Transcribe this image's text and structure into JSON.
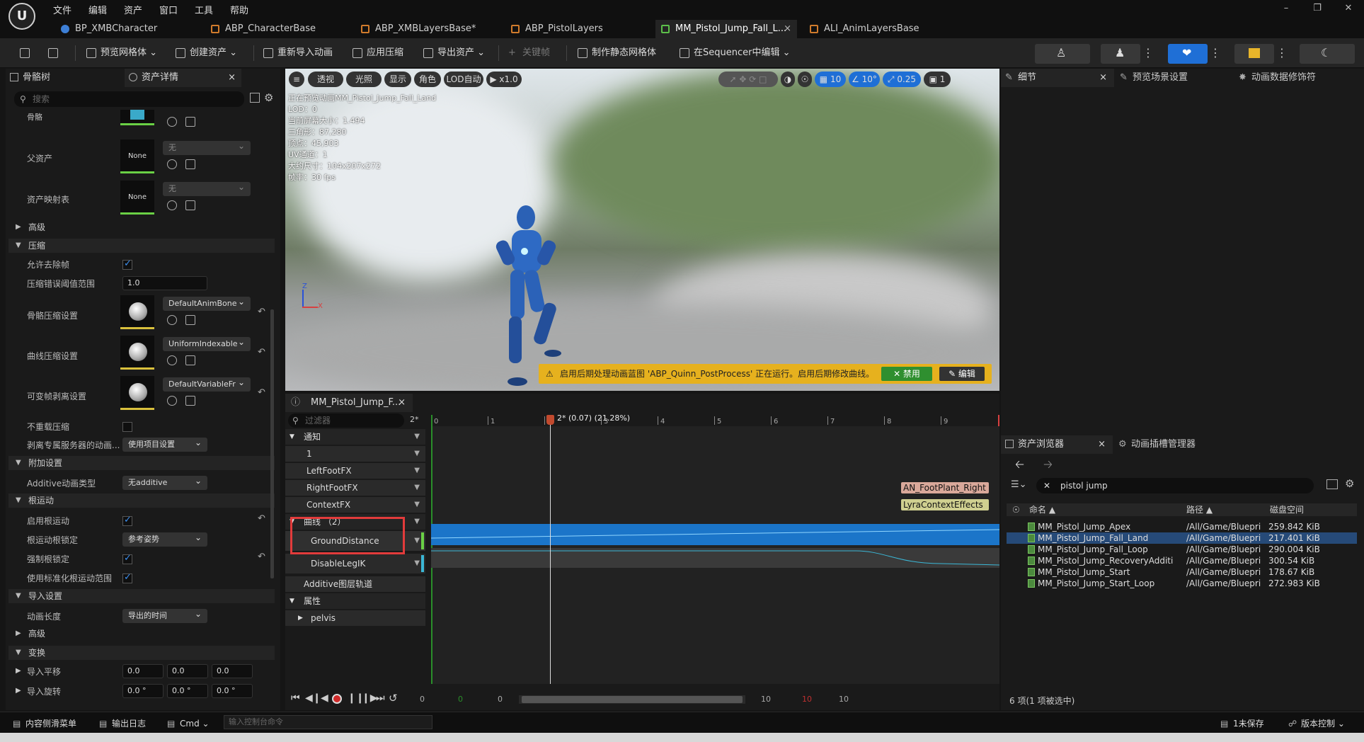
{
  "menu": {
    "items": [
      "文件",
      "编辑",
      "资产",
      "窗口",
      "工具",
      "帮助"
    ]
  },
  "tabs": [
    {
      "label": "BP_XMBCharacter"
    },
    {
      "label": "ABP_CharacterBase"
    },
    {
      "label": "ABP_XMBLayersBase*"
    },
    {
      "label": "ABP_PistolLayers"
    },
    {
      "label": "MM_Pistol_Jump_Fall_L...",
      "close": "×"
    },
    {
      "label": "ALI_AnimLayersBase"
    }
  ],
  "toolbar": {
    "preview_mesh": "预览网格体",
    "create_asset": "创建资产",
    "reimport": "重新导入动画",
    "apply_compression": "应用压缩",
    "export_asset": "导出资产",
    "keyframe": "关键帧",
    "make_static_mesh": "制作静态网格体",
    "edit_in_sequencer": "在Sequencer中编辑"
  },
  "left": {
    "tab_skeleton": "骨骼树",
    "tab_details": "资产详情",
    "tab_close": "×",
    "search_placeholder": "搜索",
    "label_skeleton": "骨骼",
    "label_parent": "父资产",
    "parent_value": "None",
    "parent_dd": "无",
    "label_mapping": "资产映射表",
    "mapping_value": "None",
    "mapping_dd": "无",
    "sec_advanced1": "高级",
    "sec_compression": "压缩",
    "allow_strip": "允许去除帧",
    "compress_err_label": "压缩错误阈值范围",
    "compress_err_value": "1.0",
    "bone_comp_label": "骨骼压缩设置",
    "bone_comp_value": "DefaultAnimBone",
    "curve_comp_label": "曲线压缩设置",
    "curve_comp_value": "UniformIndexable",
    "variable_label": "可变帧剥离设置",
    "variable_value": "DefaultVariableFr",
    "no_recompress": "不重载压缩",
    "strip_server_label": "剥离专属服务器的动画...",
    "strip_server_value": "使用项目设置",
    "sec_additive": "附加设置",
    "additive_type_label": "Additive动画类型",
    "additive_type_value": "无additive",
    "sec_root": "根运动",
    "enable_root": "启用根运动",
    "root_lock_label": "根运动根锁定",
    "root_lock_value": "参考姿势",
    "force_root_lock": "强制根锁定",
    "normalize_root": "使用标准化根运动范围",
    "sec_import": "导入设置",
    "anim_length_label": "动画长度",
    "anim_length_value": "导出的时间",
    "sec_advanced2": "高级",
    "sec_transform": "变换",
    "import_translation": "导入平移",
    "trans_x": "0.0",
    "trans_y": "0.0",
    "trans_z": "0.0",
    "import_rotation": "导入旋转",
    "rot_x": "0.0 °",
    "rot_y": "0.0 °",
    "rot_z": "0.0 °"
  },
  "viewport": {
    "menu_btn": "≡",
    "perspective": "透视",
    "lighting": "光照",
    "show": "显示",
    "character": "角色",
    "lod": "LOD自动",
    "speed": "x1.0",
    "grid": "10",
    "angle": "10°",
    "scale": "0.25",
    "cam": "1",
    "stats": [
      "正在预览动画MM_Pistol_Jump_Fall_Land",
      "LOD：0",
      "当前屏幕大小：1.494",
      "三角形：87,280",
      "顶点：45,903",
      "UV通道：1",
      "大约尺寸：104x207x272",
      "帧率：30 fps"
    ],
    "warning": "启用后期处理动画蓝图 'ABP_Quinn_PostProcess' 正在运行。启用后期修改曲线。",
    "warn_disable": "✕ 禁用",
    "warn_edit": "✎ 编辑"
  },
  "sequencer": {
    "tab": "MM_Pistol_Jump_F...",
    "tab_close": "×",
    "filter_placeholder": "过滤器",
    "filter_count": "2*",
    "tracks": {
      "notify": "通知",
      "t1": "1",
      "left_foot": "LeftFootFX",
      "right_foot": "RightFootFX",
      "context": "ContextFX",
      "curves": "曲线  （2）",
      "ground": "GroundDistance",
      "disable_ik": "DisableLegIK",
      "additive_layer": "Additive图层轨道",
      "attributes": "属性",
      "pelvis": "pelvis"
    },
    "playhead": "2* (0.07) (21.28%)",
    "ticks": [
      "0",
      "1",
      "2",
      "3",
      "4",
      "5",
      "6",
      "7",
      "8",
      "9"
    ],
    "notify_right": "AN_FootPlant_Right",
    "notify_context": "LyraContextEffects",
    "range_start": "0",
    "range_start_g": "0",
    "range_cur": "0",
    "range_end1": "10",
    "range_end_r": "10",
    "range_end2": "10"
  },
  "right": {
    "tab_details": "细节",
    "tab_close": "×",
    "tab_preview": "预览场景设置",
    "tab_modifiers": "动画数据修饰符"
  },
  "browser": {
    "tab": "资产浏览器",
    "tab_close": "×",
    "tab_slots": "动画插槽管理器",
    "search": "pistol jump",
    "col_name": "命名",
    "col_path": "路径",
    "col_size": "磁盘空间",
    "rows": [
      {
        "name": "MM_Pistol_Jump_Apex",
        "path": "/All/Game/Bluepri",
        "size": "259.842 KiB"
      },
      {
        "name": "MM_Pistol_Jump_Fall_Land",
        "path": "/All/Game/Bluepri",
        "size": "217.401 KiB"
      },
      {
        "name": "MM_Pistol_Jump_Fall_Loop",
        "path": "/All/Game/Bluepri",
        "size": "290.004 KiB"
      },
      {
        "name": "MM_Pistol_Jump_RecoveryAdditi",
        "path": "/All/Game/Bluepri",
        "size": "300.54 KiB"
      },
      {
        "name": "MM_Pistol_Jump_Start",
        "path": "/All/Game/Bluepri",
        "size": "178.67 KiB"
      },
      {
        "name": "MM_Pistol_Jump_Start_Loop",
        "path": "/All/Game/Bluepri",
        "size": "272.983 KiB"
      }
    ],
    "count": "6 项(1 项被选中)"
  },
  "statusbar": {
    "content_drawer": "内容侧滑菜单",
    "output_log": "输出日志",
    "cmd": "Cmd",
    "cmd_placeholder": "输入控制台命令",
    "unsaved": "1未保存",
    "revision": "版本控制"
  }
}
